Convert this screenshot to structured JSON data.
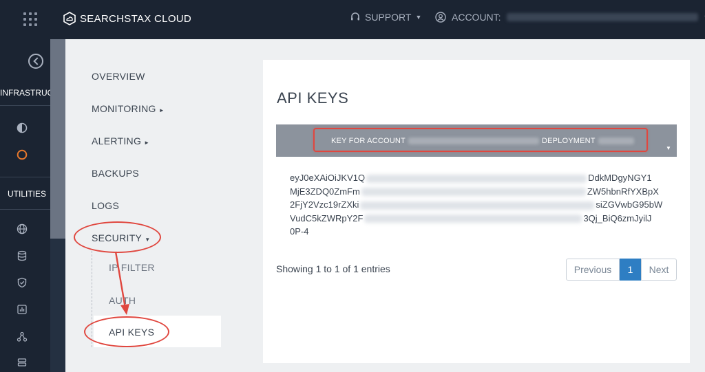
{
  "header": {
    "brand": "SEARCHSTAX CLOUD",
    "support_label": "SUPPORT",
    "account_label": "ACCOUNT:"
  },
  "rail": {
    "infrastructure_label": "INFRASTRUCT",
    "utilities_label": "UTILITIES",
    "colors": {
      "active": "#e8782c",
      "icon": "#a9b1bf"
    }
  },
  "subnav": {
    "items": [
      {
        "label": "OVERVIEW"
      },
      {
        "label": "MONITORING"
      },
      {
        "label": "ALERTING"
      },
      {
        "label": "BACKUPS"
      },
      {
        "label": "LOGS"
      },
      {
        "label": "SECURITY"
      }
    ],
    "security_children": [
      {
        "label": "IP FILTER"
      },
      {
        "label": "AUTH"
      },
      {
        "label": "API KEYS"
      }
    ]
  },
  "main": {
    "title": "API KEYS",
    "table": {
      "header_prefix": "KEY FOR ACCOUNT",
      "header_middle": "DEPLOYMENT"
    },
    "key_lines": [
      "eyJ0eXAiOiJKV1Q",
      "DdkMDgyNGY1",
      "MjE3ZDQ0ZmFm",
      "ZW5hbnRfYXBpX",
      "2FjY2Vzc19rZXki",
      "siZGVwbG95bW",
      "VudC5kZWRpY2F",
      "3Qj_BiQ6zmJyilJ",
      "0P-4"
    ],
    "showing": "Showing 1 to 1 of 1 entries",
    "pager": {
      "previous": "Previous",
      "current": "1",
      "next": "Next"
    }
  }
}
